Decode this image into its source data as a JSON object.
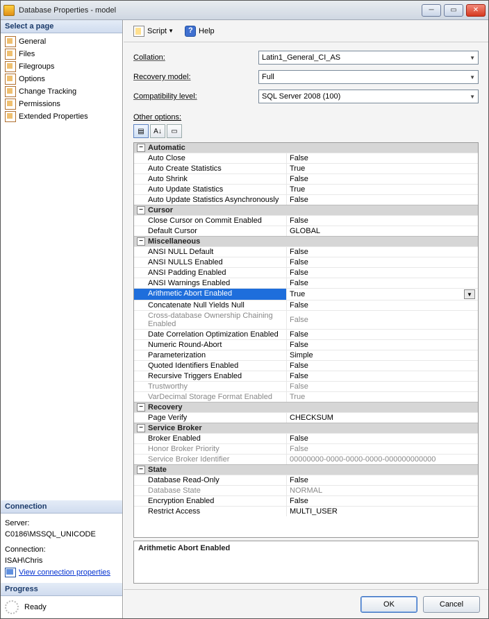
{
  "window": {
    "title": "Database Properties - model"
  },
  "sidebar": {
    "select_page": "Select a page",
    "items": [
      {
        "label": "General"
      },
      {
        "label": "Files"
      },
      {
        "label": "Filegroups"
      },
      {
        "label": "Options"
      },
      {
        "label": "Change Tracking"
      },
      {
        "label": "Permissions"
      },
      {
        "label": "Extended Properties"
      }
    ],
    "connection_header": "Connection",
    "server_label": "Server:",
    "server_value": "C0186\\MSSQL_UNICODE",
    "connection_label": "Connection:",
    "connection_value": "ISAH\\Chris",
    "view_conn_link": "View connection properties",
    "progress_header": "Progress",
    "progress_status": "Ready"
  },
  "toolbar": {
    "script": "Script",
    "help": "Help"
  },
  "form": {
    "collation_label": "Collation:",
    "collation_value": "Latin1_General_CI_AS",
    "recovery_label": "Recovery model:",
    "recovery_value": "Full",
    "compat_label": "Compatibility level:",
    "compat_value": "SQL Server 2008 (100)",
    "other_options": "Other options:"
  },
  "grid": {
    "categories": [
      {
        "name": "Automatic",
        "rows": [
          {
            "n": "Auto Close",
            "v": "False"
          },
          {
            "n": "Auto Create Statistics",
            "v": "True"
          },
          {
            "n": "Auto Shrink",
            "v": "False"
          },
          {
            "n": "Auto Update Statistics",
            "v": "True"
          },
          {
            "n": "Auto Update Statistics Asynchronously",
            "v": "False"
          }
        ]
      },
      {
        "name": "Cursor",
        "rows": [
          {
            "n": "Close Cursor on Commit Enabled",
            "v": "False"
          },
          {
            "n": "Default Cursor",
            "v": "GLOBAL"
          }
        ]
      },
      {
        "name": "Miscellaneous",
        "rows": [
          {
            "n": "ANSI NULL Default",
            "v": "False"
          },
          {
            "n": "ANSI NULLS Enabled",
            "v": "False"
          },
          {
            "n": "ANSI Padding Enabled",
            "v": "False"
          },
          {
            "n": "ANSI Warnings Enabled",
            "v": "False"
          },
          {
            "n": "Arithmetic Abort Enabled",
            "v": "True",
            "selected": true
          },
          {
            "n": "Concatenate Null Yields Null",
            "v": "False"
          },
          {
            "n": "Cross-database Ownership Chaining Enabled",
            "v": "False",
            "dim": true
          },
          {
            "n": "Date Correlation Optimization Enabled",
            "v": "False"
          },
          {
            "n": "Numeric Round-Abort",
            "v": "False"
          },
          {
            "n": "Parameterization",
            "v": "Simple"
          },
          {
            "n": "Quoted Identifiers Enabled",
            "v": "False"
          },
          {
            "n": "Recursive Triggers Enabled",
            "v": "False"
          },
          {
            "n": "Trustworthy",
            "v": "False",
            "dim": true
          },
          {
            "n": "VarDecimal Storage Format Enabled",
            "v": "True",
            "dim": true
          }
        ]
      },
      {
        "name": "Recovery",
        "rows": [
          {
            "n": "Page Verify",
            "v": "CHECKSUM"
          }
        ]
      },
      {
        "name": "Service Broker",
        "rows": [
          {
            "n": "Broker Enabled",
            "v": "False"
          },
          {
            "n": "Honor Broker Priority",
            "v": "False",
            "dim": true
          },
          {
            "n": "Service Broker Identifier",
            "v": "00000000-0000-0000-0000-000000000000",
            "dim": true
          }
        ]
      },
      {
        "name": "State",
        "rows": [
          {
            "n": "Database Read-Only",
            "v": "False"
          },
          {
            "n": "Database State",
            "v": "NORMAL",
            "dim": true
          },
          {
            "n": "Encryption Enabled",
            "v": "False"
          },
          {
            "n": "Restrict Access",
            "v": "MULTI_USER"
          }
        ]
      }
    ]
  },
  "desc": {
    "title": "Arithmetic Abort Enabled"
  },
  "footer": {
    "ok": "OK",
    "cancel": "Cancel"
  }
}
